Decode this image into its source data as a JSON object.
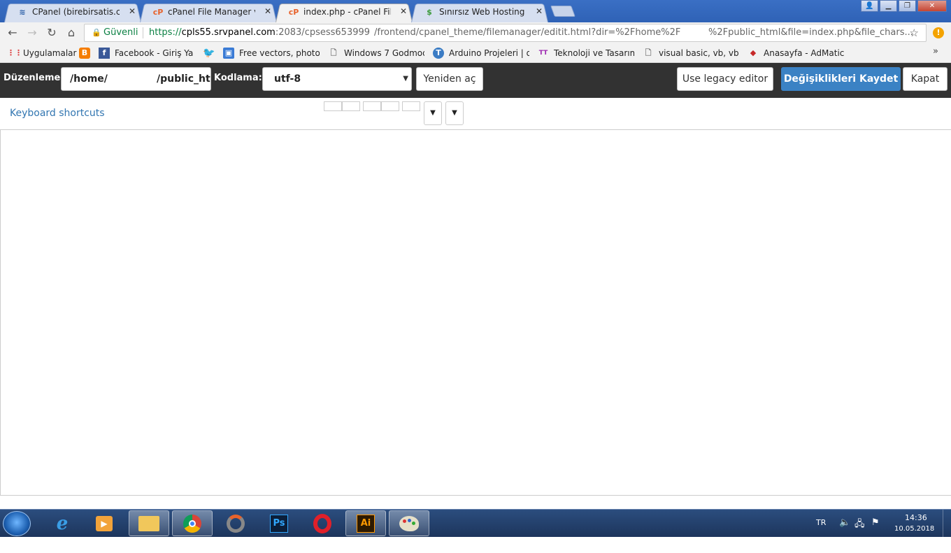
{
  "browser": {
    "tabs": [
      {
        "title": "CPanel (birebirsatis.com)",
        "favicon": "≋",
        "color": "#2b5fa8",
        "active": false
      },
      {
        "title": "cPanel File Manager v3",
        "favicon": "cP",
        "color": "#e8632c",
        "active": false
      },
      {
        "title": "index.php - cPanel File M",
        "favicon": "cP",
        "color": "#e8632c",
        "active": true
      },
      {
        "title": "Sınırsız Web Hosting | Tü",
        "favicon": "$",
        "color": "#3c9a3c",
        "active": false
      }
    ],
    "url": {
      "secure_label": "Güvenli",
      "host_prefix": "https://",
      "host": "cpls55.srvpanel.com",
      "path_a": ":2083/cpsess653999",
      "path_b": "/frontend/cpanel_theme/filemanager/editit.html?dir=%2Fhome%2F",
      "path_c": "%2Fpublic_html&file=index.php&file_chars..."
    },
    "bookmarks": [
      {
        "label": "Uygulamalar",
        "icon": "apps-grid-icon",
        "color": "#d44"
      },
      {
        "label": "",
        "icon": "blogger-icon",
        "color": "#f57d00"
      },
      {
        "label": "Facebook - Giriş Yap",
        "icon": "facebook-icon",
        "color": "#3b5998"
      },
      {
        "label": "",
        "icon": "twitter-icon",
        "color": "#1da1f2"
      },
      {
        "label": "Free vectors, photos a",
        "icon": "freepik-icon",
        "color": "#3a7bd5"
      },
      {
        "label": "Windows 7 Godmode",
        "icon": "page-icon",
        "color": "#777"
      },
      {
        "label": "Arduino Projeleri | diy",
        "icon": "arduino-icon",
        "color": "#3b7cc4"
      },
      {
        "label": "Teknoloji ve Tasarım",
        "icon": "teknoloji-icon",
        "color": "#9c27b0"
      },
      {
        "label": "visual basic, vb, vbscr",
        "icon": "page-icon",
        "color": "#777"
      },
      {
        "label": "Anasayfa - AdMatic",
        "icon": "admatic-icon",
        "color": "#c62828"
      }
    ],
    "more": "»"
  },
  "editor": {
    "editing_label": "Düzenleme:",
    "path_a": "/home/",
    "path_b": "/public_ht",
    "encoding_label": "Kodlama:",
    "encoding_value": "utf-8",
    "reopen": "Yeniden aç",
    "legacy": "Use legacy editor",
    "save": "Değişiklikleri Kaydet",
    "close": "Kapat",
    "shortcuts": "Keyboard shortcuts"
  },
  "taskbar": {
    "apps": [
      "internet-explorer-icon",
      "media-player-icon",
      "explorer-folder-icon",
      "chrome-icon",
      "recycle-tool-icon",
      "photoshop-icon",
      "opera-icon",
      "illustrator-icon",
      "paint-icon"
    ],
    "ps": "Ps",
    "ai": "Ai",
    "lang": "TR",
    "time": "14:36",
    "date": "10.05.2018"
  }
}
